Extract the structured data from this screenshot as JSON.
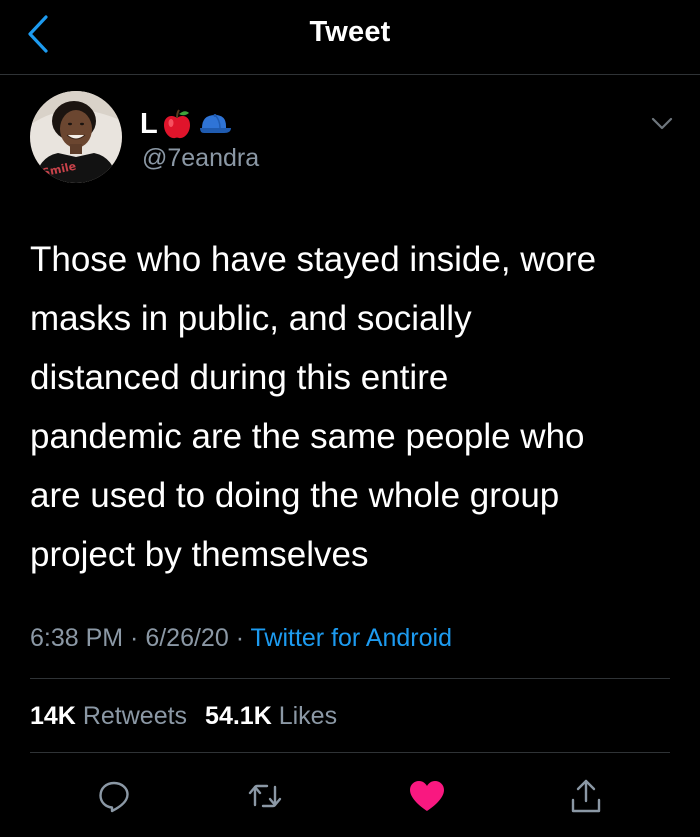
{
  "header": {
    "title": "Tweet",
    "back_icon": "chevron-left-icon"
  },
  "author": {
    "name": "L",
    "emojis": [
      "red-apple",
      "blue-cap"
    ],
    "handle": "@7eandra",
    "avatar_shirt_text": "Smile"
  },
  "tweet": {
    "text": "Those who have stayed inside, wore\nmasks in public, and socially\ndistanced during this entire\npandemic are the same people who\nare used to doing the whole group\nproject by themselves",
    "time": "6:38 PM",
    "separator": " · ",
    "date": "6/26/20",
    "source": "Twitter for Android"
  },
  "stats": {
    "retweets_count": "14K",
    "retweets_label": "Retweets",
    "likes_count": "54.1K",
    "likes_label": "Likes"
  },
  "actions": {
    "reply": "reply-icon",
    "retweet": "retweet-icon",
    "like": "heart-icon",
    "share": "share-icon",
    "liked": true
  },
  "colors": {
    "background": "#000000",
    "accent": "#1d9bf0",
    "like": "#f91880",
    "secondary_text": "#8b98a5",
    "divider": "#2f3336"
  }
}
